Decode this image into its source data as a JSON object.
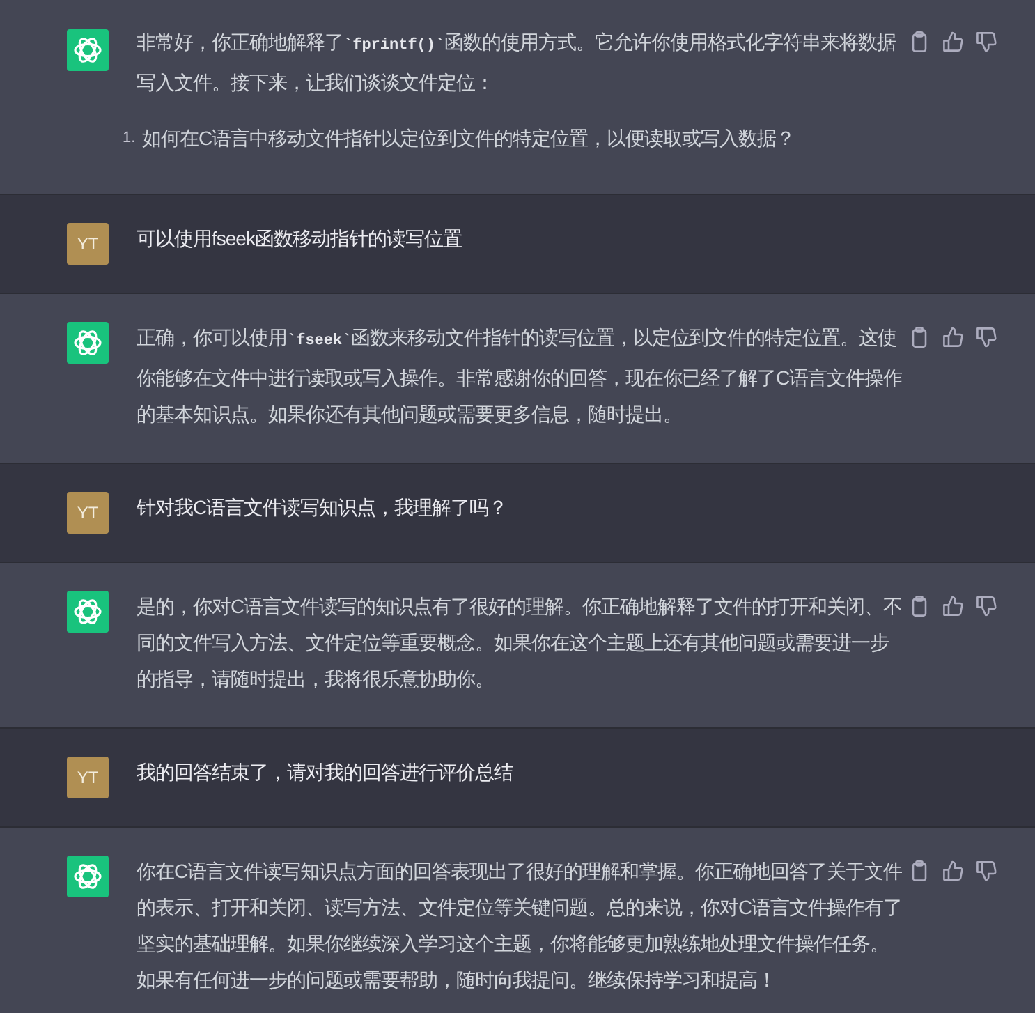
{
  "messages": [
    {
      "kind": "assistant",
      "text": "非常好，你正确地解释了**`fprintf()`**函数的使用方式。它允许你使用格式化字符串来将数据写入文件。接下来，让我们谈谈文件定位：",
      "list": [
        {
          "number": "1.",
          "text": "如何在C语言中移动文件指针以定位到文件的特定位置，以便读取或写入数据？"
        }
      ]
    },
    {
      "kind": "user",
      "avatar": "YT",
      "text": "可以使用fseek函数移动指针的读写位置"
    },
    {
      "kind": "assistant",
      "text": "正确，你可以使用**`fseek`**函数来移动文件指针的读写位置，以定位到文件的特定位置。这使你能够在文件中进行读取或写入操作。非常感谢你的回答，现在你已经了解了C语言文件操作的基本知识点。如果你还有其他问题或需要更多信息，随时提出。"
    },
    {
      "kind": "user",
      "avatar": "YT",
      "text": "针对我C语言文件读写知识点，我理解了吗？"
    },
    {
      "kind": "assistant",
      "text": "是的，你对C语言文件读写的知识点有了很好的理解。你正确地解释了文件的打开和关闭、不同的文件写入方法、文件定位等重要概念。如果你在这个主题上还有其他问题或需要进一步的指导，请随时提出，我将很乐意协助你。"
    },
    {
      "kind": "user",
      "avatar": "YT",
      "text": "我的回答结束了，请对我的回答进行评价总结"
    },
    {
      "kind": "assistant",
      "text": "你在C语言文件读写知识点方面的回答表现出了很好的理解和掌握。你正确地回答了关于文件的表示、打开和关闭、读写方法、文件定位等关键问题。总的来说，你对C语言文件操作有了坚实的基础理解。如果你继续深入学习这个主题，你将能够更加熟练地处理文件操作任务。如果有任何进一步的问题或需要帮助，随时向我提问。继续保持学习和提高！"
    }
  ]
}
